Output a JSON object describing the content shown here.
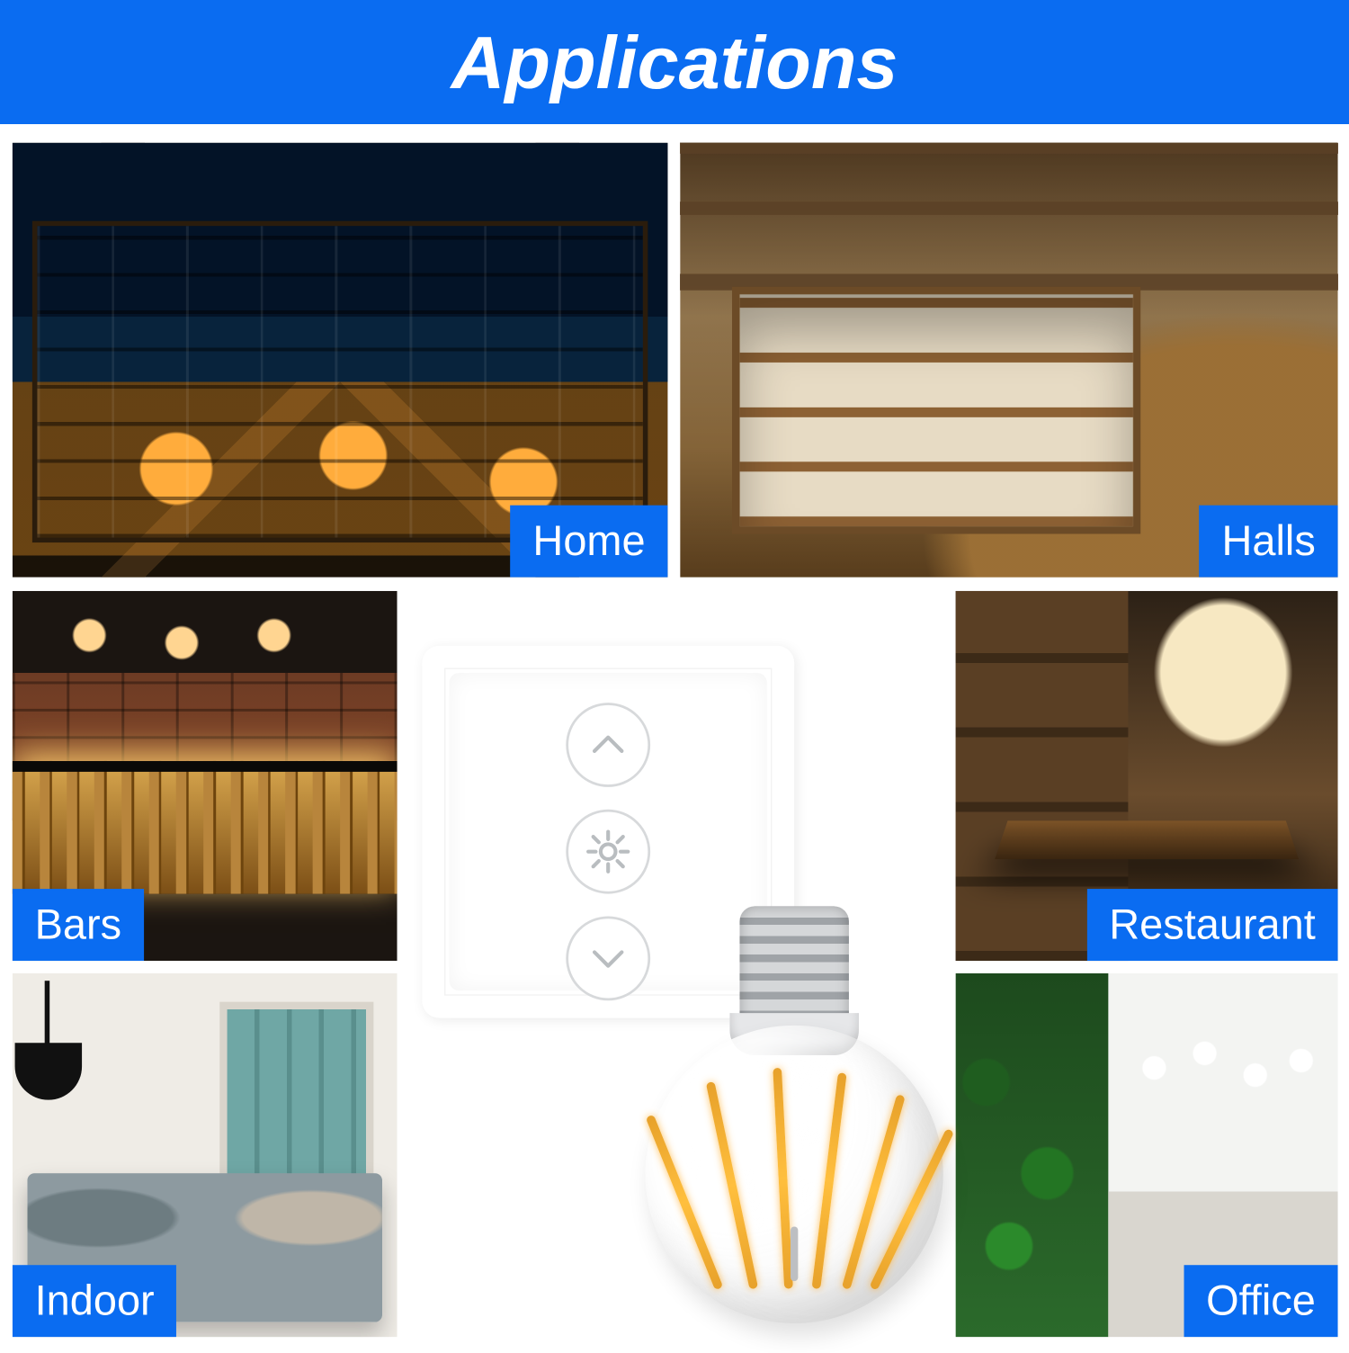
{
  "header": {
    "title": "Applications"
  },
  "tiles": {
    "home": {
      "label": "Home"
    },
    "halls": {
      "label": "Halls"
    },
    "bars": {
      "label": "Bars"
    },
    "restaurant": {
      "label": "Restaurant"
    },
    "indoor": {
      "label": "Indoor"
    },
    "office": {
      "label": "Office"
    }
  },
  "product": {
    "dimmer_buttons": {
      "up": "brightness-up",
      "mid": "light-toggle",
      "down": "brightness-down"
    },
    "bulb": "filament-bulb"
  },
  "colors": {
    "brand_blue": "#0a6cf1"
  }
}
